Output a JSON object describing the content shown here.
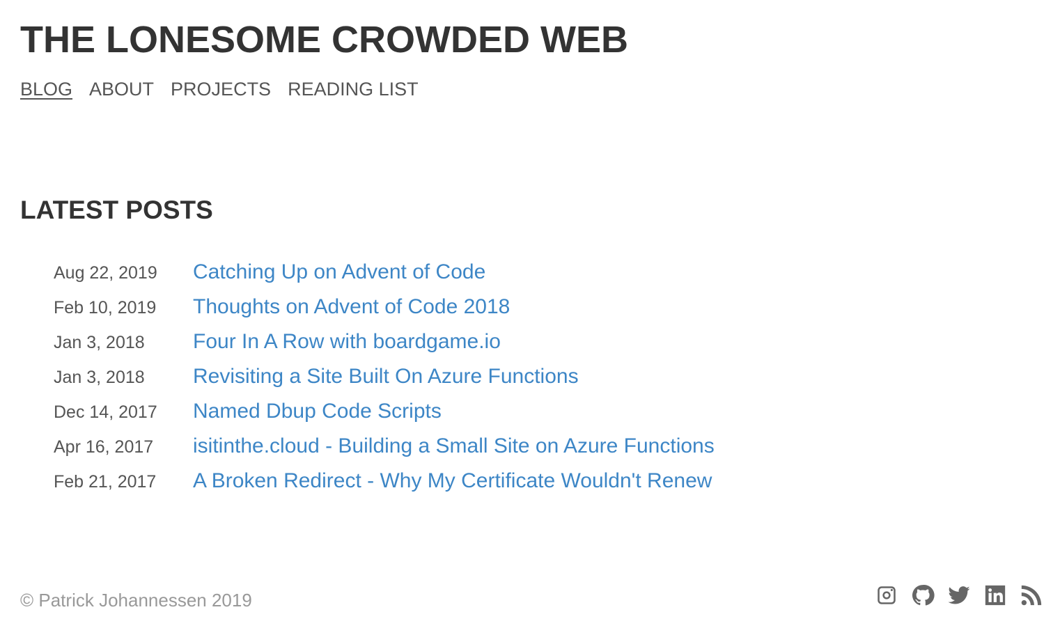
{
  "site": {
    "title": "THE LONESOME CROWDED WEB"
  },
  "nav": {
    "items": [
      {
        "label": "BLOG",
        "active": true
      },
      {
        "label": "ABOUT",
        "active": false
      },
      {
        "label": "PROJECTS",
        "active": false
      },
      {
        "label": "READING LIST",
        "active": false
      }
    ]
  },
  "main": {
    "section_title": "LATEST POSTS",
    "posts": [
      {
        "date": "Aug 22, 2019",
        "title": "Catching Up on Advent of Code"
      },
      {
        "date": "Feb 10, 2019",
        "title": "Thoughts on Advent of Code 2018"
      },
      {
        "date": "Jan 3, 2018",
        "title": "Four In A Row with boardgame.io"
      },
      {
        "date": "Jan 3, 2018",
        "title": "Revisiting a Site Built On Azure Functions"
      },
      {
        "date": "Dec 14, 2017",
        "title": "Named Dbup Code Scripts"
      },
      {
        "date": "Apr 16, 2017",
        "title": "isitinthe.cloud - Building a Small Site on Azure Functions"
      },
      {
        "date": "Feb 21, 2017",
        "title": "A Broken Redirect - Why My Certificate Wouldn't Renew"
      }
    ]
  },
  "footer": {
    "copyright": "© Patrick Johannessen 2019",
    "social": [
      {
        "icon": "instagram-icon"
      },
      {
        "icon": "github-icon"
      },
      {
        "icon": "twitter-icon"
      },
      {
        "icon": "linkedin-icon"
      },
      {
        "icon": "rss-icon"
      }
    ]
  },
  "colors": {
    "link": "#3d86c6",
    "heading": "#333333",
    "nav": "#555555",
    "muted": "#999999",
    "icon": "#666666"
  }
}
